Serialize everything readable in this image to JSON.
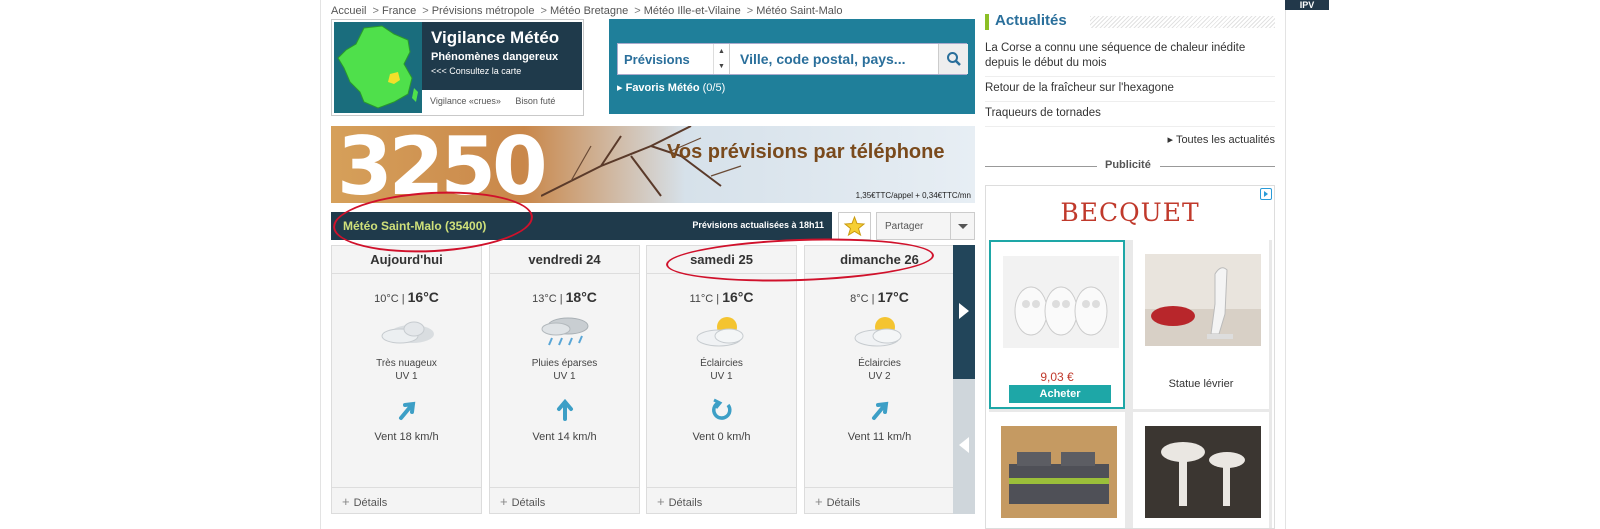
{
  "breadcrumb": [
    "Accueil",
    "France",
    "Prévisions métropole",
    "Météo Bretagne",
    "Météo Ille-et-Vilaine",
    "Météo Saint-Malo"
  ],
  "top_corner_badge": "IPV",
  "vigilance": {
    "title": "Vigilance Météo",
    "subtitle": "Phénomènes dangereux",
    "link": "<<< Consultez la carte",
    "footer_links": [
      "Vigilance «crues»",
      "Bison futé"
    ]
  },
  "search": {
    "select_value": "Prévisions",
    "placeholder": "Ville, code postal, pays...",
    "favoris_label": "Favoris Météo",
    "favoris_count": "(0/5)"
  },
  "banner": {
    "number": "3250",
    "text": "Vos prévisions par téléphone",
    "price": "1,35€TTC/appel + 0,34€TTC/mn"
  },
  "forecast": {
    "city_title": "Météo Saint-Malo (35400)",
    "update_text": "Prévisions actualisées à 18h11",
    "share_label": "Partager",
    "details_label": "Détails",
    "days": [
      {
        "name": "Aujourd'hui",
        "min": "10°C",
        "max": "16°C",
        "icon": "overcast-icon",
        "desc": "Très nuageux",
        "uv": "UV 1",
        "wind_icon": "wind-arrow-northeast-icon",
        "wind": "Vent 18 km/h"
      },
      {
        "name": "vendredi 24",
        "min": "13°C",
        "max": "18°C",
        "icon": "rain-showers-icon",
        "desc": "Pluies éparses",
        "uv": "UV 1",
        "wind_icon": "wind-arrow-north-icon",
        "wind": "Vent 14 km/h"
      },
      {
        "name": "samedi 25",
        "min": "11°C",
        "max": "16°C",
        "icon": "partly-sunny-icon",
        "desc": "Éclaircies",
        "uv": "UV 1",
        "wind_icon": "wind-variable-icon",
        "wind": "Vent 0 km/h"
      },
      {
        "name": "dimanche 26",
        "min": "8°C",
        "max": "17°C",
        "icon": "partly-sunny-icon",
        "desc": "Éclaircies",
        "uv": "UV 2",
        "wind_icon": "wind-arrow-northeast-icon",
        "wind": "Vent 11 km/h"
      }
    ]
  },
  "actualites": {
    "title": "Actualités",
    "items": [
      "La Corse a connu une séquence de chaleur inédite depuis le début du mois",
      "Retour de la fraîcheur sur l'hexagone",
      "Traqueurs de tornades"
    ],
    "all_link": "Toutes les actualités"
  },
  "pub_label": "Publicité",
  "ad": {
    "brand": "BECQUET",
    "products": [
      {
        "name": "owl-figurines",
        "price": "9,03 €",
        "button": "Acheter"
      },
      {
        "name": "Statue lévrier"
      },
      {
        "name": "bedding-set"
      },
      {
        "name": "mushroom-lamps"
      }
    ]
  },
  "colors": {
    "dark_navy": "#1f3a4b",
    "teal": "#1f7f9a",
    "accent_green": "#8cbf26",
    "annotation_red": "#d0112b",
    "ad_red": "#c0392b",
    "ad_button": "#1ea7a7"
  }
}
